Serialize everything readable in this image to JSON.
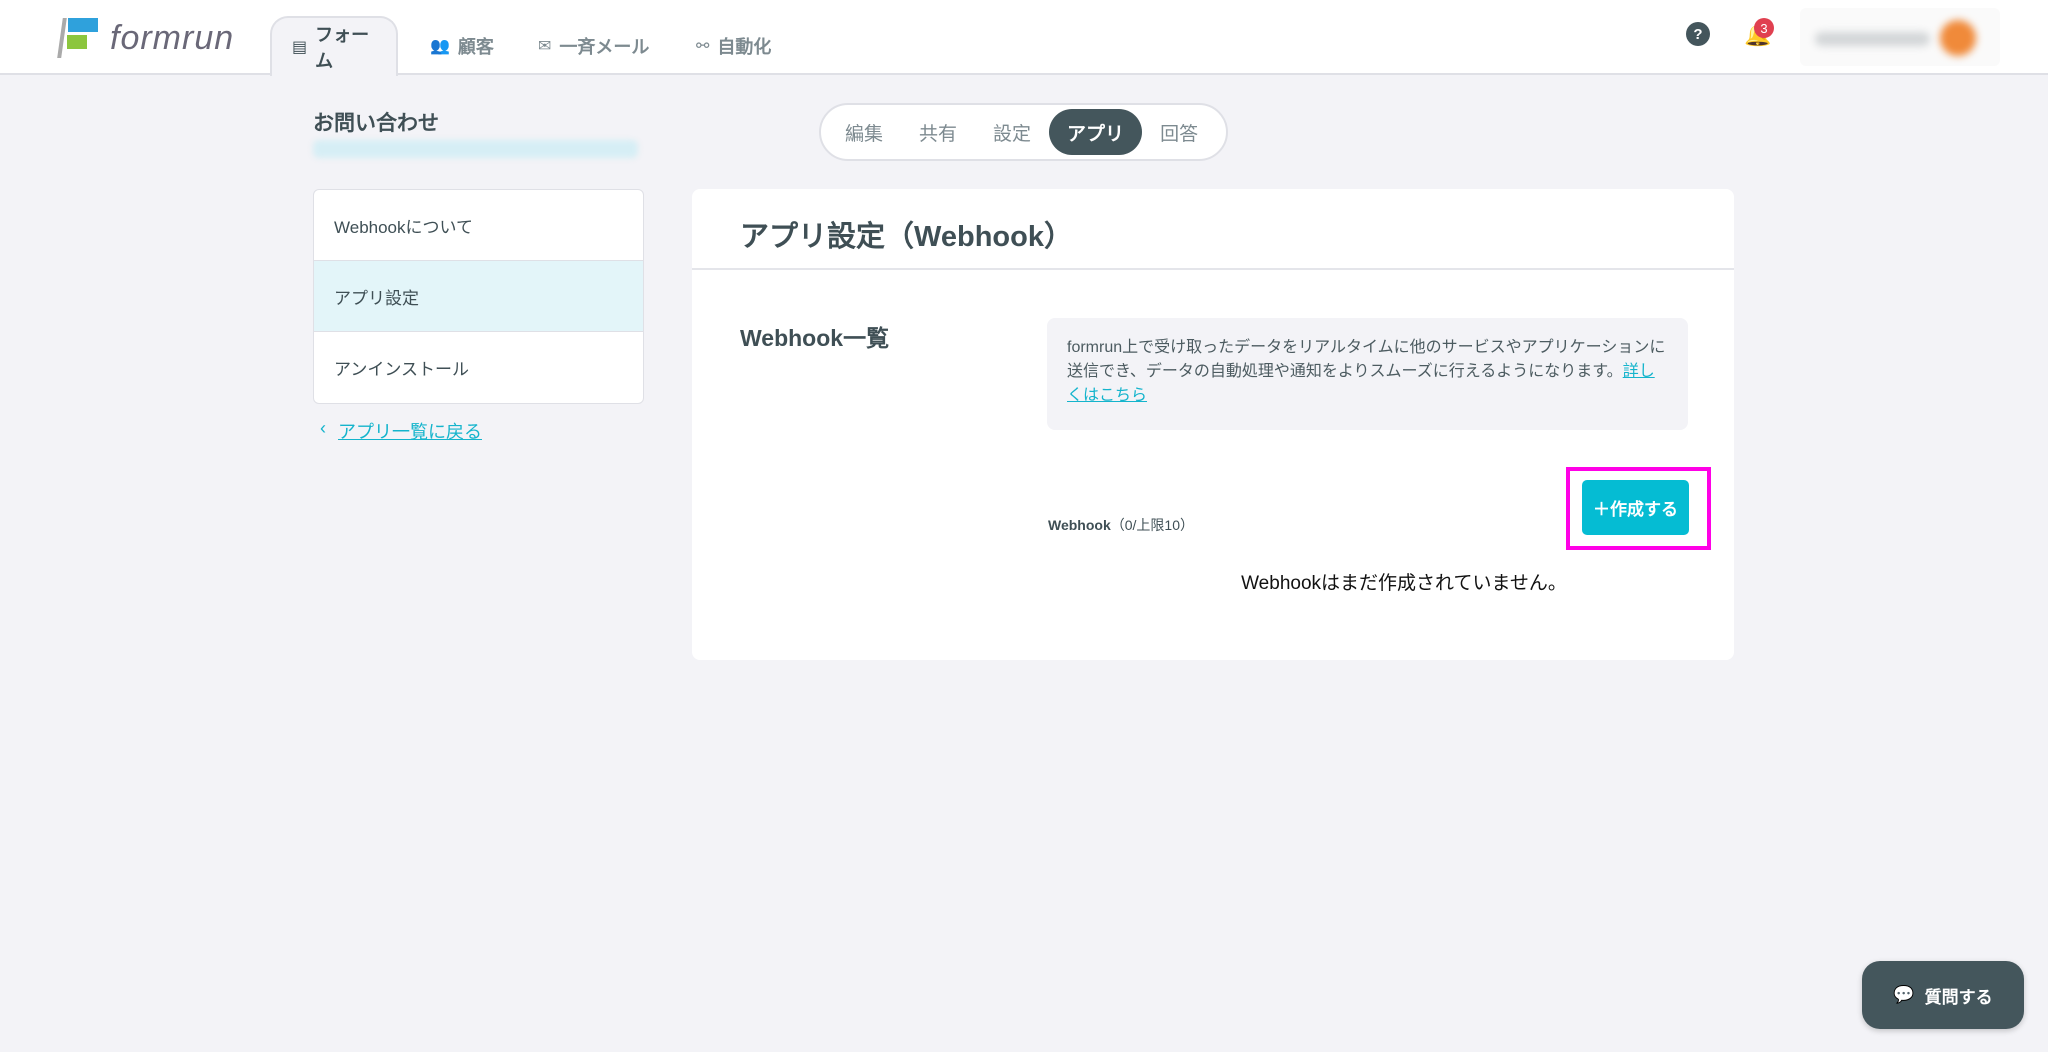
{
  "header": {
    "logo": "formrun",
    "nav": [
      {
        "label": "フォーム",
        "icon": "form-icon"
      },
      {
        "label": "顧客",
        "icon": "users-icon"
      },
      {
        "label": "一斉メール",
        "icon": "mail-icon"
      },
      {
        "label": "自動化",
        "icon": "automation-icon"
      }
    ],
    "help": "?",
    "notification_count": "3"
  },
  "form": {
    "title": "お問い合わせ"
  },
  "tabs": [
    "編集",
    "共有",
    "設定",
    "アプリ",
    "回答"
  ],
  "sidebar": {
    "items": [
      "Webhookについて",
      "アプリ設定",
      "アンインストール"
    ],
    "back": "アプリ一覧に戻る"
  },
  "main": {
    "title": "アプリ設定（Webhook）",
    "section": "Webhook一覧",
    "info": "formrun上で受け取ったデータをリアルタイムに他のサービスやアプリケーションに送信でき、データの自動処理や通知をよりスムーズに行えるようになります。",
    "info_link": "詳しくはこちら",
    "count_label": "Webhook",
    "count_value": "（0/上限10）",
    "create_button": "＋作成する",
    "empty": "Webhookはまだ作成されていません。"
  },
  "chat_button": "質問する",
  "colors": {
    "accent": "#05bcd3",
    "dark": "#44565c",
    "highlight": "#ff00e6"
  }
}
